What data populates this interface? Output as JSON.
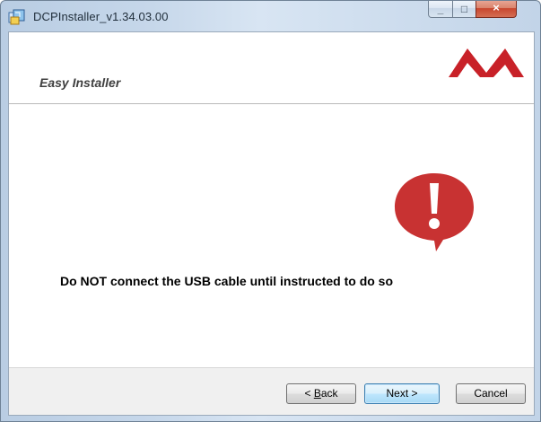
{
  "window": {
    "title": "DCPInstaller_v1.34.03.00",
    "app_icon": "installer-icon",
    "caption_buttons": {
      "minimize": "minimize-icon",
      "maximize": "maximize-icon",
      "close": "close-icon"
    }
  },
  "header": {
    "title": "Easy Installer",
    "logo_icon": "brand-logo-icon"
  },
  "main": {
    "alert_icon": "exclamation-speech-bubble-icon",
    "message": "Do NOT connect the USB cable until instructed to do so"
  },
  "footer": {
    "back_prefix": "< ",
    "back_accesskey": "B",
    "back_suffix": "ack",
    "next_label": "Next >",
    "cancel_label": "Cancel"
  },
  "colors": {
    "accent_red": "#c82128",
    "alert_red": "#c83232",
    "default_button_border": "#3c7fb1"
  }
}
